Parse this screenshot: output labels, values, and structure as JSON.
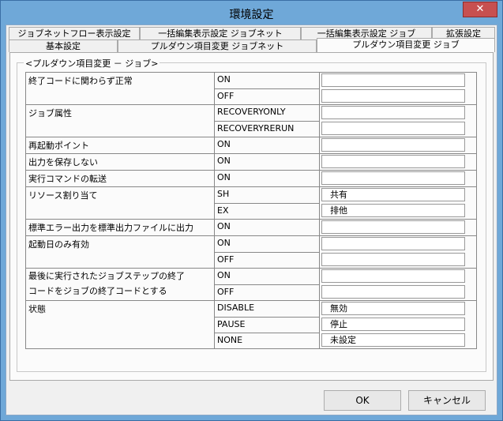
{
  "window": {
    "title": "環境設定",
    "close_label": "✕"
  },
  "tabs_row1": [
    "ジョブネットフロー表示設定",
    "一括編集表示設定 ジョブネット",
    "一括編集表示設定 ジョブ",
    "拡張設定"
  ],
  "tabs_row2": [
    "基本設定",
    "プルダウン項目変更 ジョブネット",
    "プルダウン項目変更 ジョブ"
  ],
  "group": {
    "title": "<プルダウン項目変更 － ジョブ>"
  },
  "rows": [
    {
      "name": "終了コードに関わらず正常",
      "value": "ON",
      "setting": ""
    },
    {
      "name": "",
      "value": "OFF",
      "setting": ""
    },
    {
      "name": "ジョブ属性",
      "value": "RECOVERYONLY",
      "setting": ""
    },
    {
      "name": "",
      "value": "RECOVERYRERUN",
      "setting": ""
    },
    {
      "name": "再起動ポイント",
      "value": "ON",
      "setting": ""
    },
    {
      "name": "出力を保存しない",
      "value": "ON",
      "setting": ""
    },
    {
      "name": "実行コマンドの転送",
      "value": "ON",
      "setting": ""
    },
    {
      "name": "リソース割り当て",
      "value": "SH",
      "setting": "共有"
    },
    {
      "name": "",
      "value": "EX",
      "setting": "排他"
    },
    {
      "name": "標準エラー出力を標準出力ファイルに出力",
      "value": "ON",
      "setting": ""
    },
    {
      "name": "起動日のみ有効",
      "value": "ON",
      "setting": ""
    },
    {
      "name": "",
      "value": "OFF",
      "setting": ""
    },
    {
      "name": "最後に実行されたジョブステップの終了",
      "value": "ON",
      "setting": ""
    },
    {
      "name": "コードをジョブの終了コードとする",
      "value": "OFF",
      "setting": ""
    },
    {
      "name": "状態",
      "value": "DISABLE",
      "setting": "無効"
    },
    {
      "name": "",
      "value": "PAUSE",
      "setting": "停止"
    },
    {
      "name": "",
      "value": "NONE",
      "setting": "未設定"
    }
  ],
  "buttons": {
    "ok": "OK",
    "cancel": "キャンセル"
  }
}
